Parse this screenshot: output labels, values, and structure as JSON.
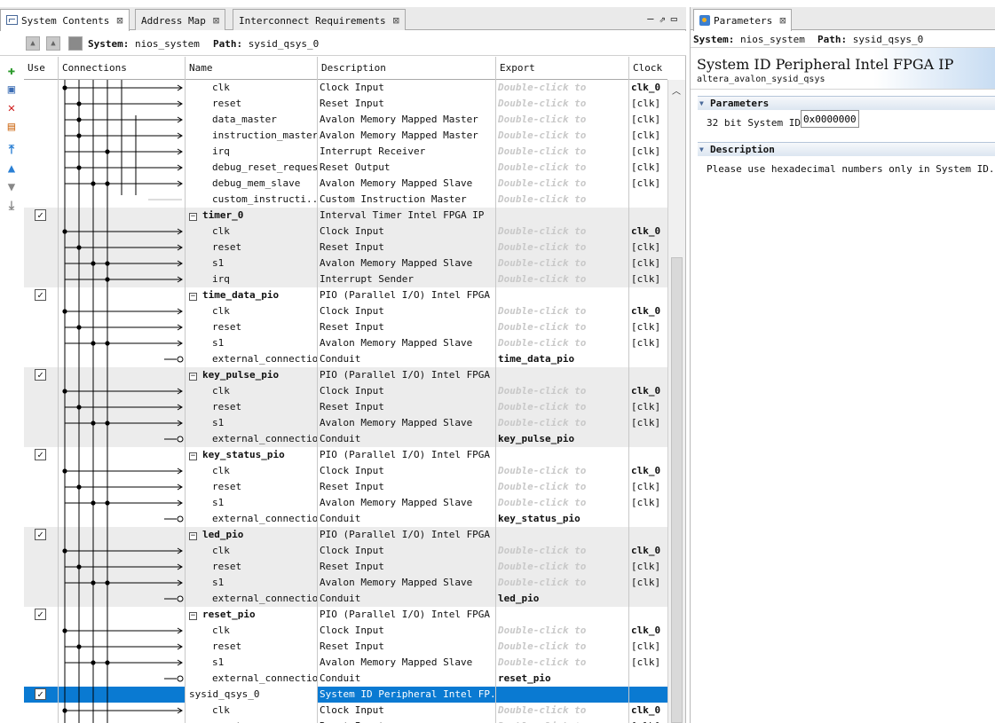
{
  "tabs": [
    {
      "label": "System Contents",
      "active": true
    },
    {
      "label": "Address Map",
      "active": false
    },
    {
      "label": "Interconnect Requirements",
      "active": false
    }
  ],
  "pathbar": {
    "system_label": "System:",
    "system_value": "nios_system",
    "path_label": "Path:",
    "path_value": "sysid_qsys_0"
  },
  "columns": {
    "use": "Use",
    "connections": "Connections",
    "name": "Name",
    "description": "Description",
    "export": "Export",
    "clock": "Clock"
  },
  "double_click_text": "Double-click to",
  "rows": [
    {
      "kind": "port",
      "name": "clk",
      "desc": "Clock Input",
      "export": "dbl",
      "clock": "clk_0",
      "clock_bold": true,
      "shade": false
    },
    {
      "kind": "port",
      "name": "reset",
      "desc": "Reset Input",
      "export": "dbl",
      "clock": "[clk]",
      "shade": false
    },
    {
      "kind": "port",
      "name": "data_master",
      "desc": "Avalon Memory Mapped Master",
      "export": "dbl",
      "clock": "[clk]",
      "shade": false
    },
    {
      "kind": "port",
      "name": "instruction_master",
      "desc": "Avalon Memory Mapped Master",
      "export": "dbl",
      "clock": "[clk]",
      "shade": false
    },
    {
      "kind": "port",
      "name": "irq",
      "desc": "Interrupt Receiver",
      "export": "dbl",
      "clock": "[clk]",
      "shade": false
    },
    {
      "kind": "port",
      "name": "debug_reset_request",
      "desc": "Reset Output",
      "export": "dbl",
      "clock": "[clk]",
      "shade": false
    },
    {
      "kind": "port",
      "name": "debug_mem_slave",
      "desc": "Avalon Memory Mapped Slave",
      "export": "dbl",
      "clock": "[clk]",
      "shade": false
    },
    {
      "kind": "port",
      "name": "custom_instructi...",
      "desc": "Custom Instruction Master",
      "export": "dbl",
      "clock": "",
      "shade": false
    },
    {
      "kind": "comp",
      "name": "timer_0",
      "desc": "Interval Timer Intel FPGA IP",
      "export": "",
      "clock": "",
      "shade": true
    },
    {
      "kind": "port",
      "name": "clk",
      "desc": "Clock Input",
      "export": "dbl",
      "clock": "clk_0",
      "clock_bold": true,
      "shade": true
    },
    {
      "kind": "port",
      "name": "reset",
      "desc": "Reset Input",
      "export": "dbl",
      "clock": "[clk]",
      "shade": true
    },
    {
      "kind": "port",
      "name": "s1",
      "desc": "Avalon Memory Mapped Slave",
      "export": "dbl",
      "clock": "[clk]",
      "shade": true
    },
    {
      "kind": "port",
      "name": "irq",
      "desc": "Interrupt Sender",
      "export": "dbl",
      "clock": "[clk]",
      "shade": true
    },
    {
      "kind": "comp",
      "name": "time_data_pio",
      "desc": "PIO (Parallel I/O) Intel FPGA IP",
      "export": "",
      "clock": "",
      "shade": false
    },
    {
      "kind": "port",
      "name": "clk",
      "desc": "Clock Input",
      "export": "dbl",
      "clock": "clk_0",
      "clock_bold": true,
      "shade": false
    },
    {
      "kind": "port",
      "name": "reset",
      "desc": "Reset Input",
      "export": "dbl",
      "clock": "[clk]",
      "shade": false
    },
    {
      "kind": "port",
      "name": "s1",
      "desc": "Avalon Memory Mapped Slave",
      "export": "dbl",
      "clock": "[clk]",
      "shade": false
    },
    {
      "kind": "port",
      "name": "external_connection",
      "desc": "Conduit",
      "export": "time_data_pio",
      "clock": "",
      "shade": false
    },
    {
      "kind": "comp",
      "name": "key_pulse_pio",
      "desc": "PIO (Parallel I/O) Intel FPGA IP",
      "export": "",
      "clock": "",
      "shade": true
    },
    {
      "kind": "port",
      "name": "clk",
      "desc": "Clock Input",
      "export": "dbl",
      "clock": "clk_0",
      "clock_bold": true,
      "shade": true
    },
    {
      "kind": "port",
      "name": "reset",
      "desc": "Reset Input",
      "export": "dbl",
      "clock": "[clk]",
      "shade": true
    },
    {
      "kind": "port",
      "name": "s1",
      "desc": "Avalon Memory Mapped Slave",
      "export": "dbl",
      "clock": "[clk]",
      "shade": true
    },
    {
      "kind": "port",
      "name": "external_connection",
      "desc": "Conduit",
      "export": "key_pulse_pio",
      "clock": "",
      "shade": true
    },
    {
      "kind": "comp",
      "name": "key_status_pio",
      "desc": "PIO (Parallel I/O) Intel FPGA IP",
      "export": "",
      "clock": "",
      "shade": false
    },
    {
      "kind": "port",
      "name": "clk",
      "desc": "Clock Input",
      "export": "dbl",
      "clock": "clk_0",
      "clock_bold": true,
      "shade": false
    },
    {
      "kind": "port",
      "name": "reset",
      "desc": "Reset Input",
      "export": "dbl",
      "clock": "[clk]",
      "shade": false
    },
    {
      "kind": "port",
      "name": "s1",
      "desc": "Avalon Memory Mapped Slave",
      "export": "dbl",
      "clock": "[clk]",
      "shade": false
    },
    {
      "kind": "port",
      "name": "external_connection",
      "desc": "Conduit",
      "export": "key_status_pio",
      "clock": "",
      "shade": false
    },
    {
      "kind": "comp",
      "name": "led_pio",
      "desc": "PIO (Parallel I/O) Intel FPGA IP",
      "export": "",
      "clock": "",
      "shade": true
    },
    {
      "kind": "port",
      "name": "clk",
      "desc": "Clock Input",
      "export": "dbl",
      "clock": "clk_0",
      "clock_bold": true,
      "shade": true
    },
    {
      "kind": "port",
      "name": "reset",
      "desc": "Reset Input",
      "export": "dbl",
      "clock": "[clk]",
      "shade": true
    },
    {
      "kind": "port",
      "name": "s1",
      "desc": "Avalon Memory Mapped Slave",
      "export": "dbl",
      "clock": "[clk]",
      "shade": true
    },
    {
      "kind": "port",
      "name": "external_connection",
      "desc": "Conduit",
      "export": "led_pio",
      "clock": "",
      "shade": true
    },
    {
      "kind": "comp",
      "name": "reset_pio",
      "desc": "PIO (Parallel I/O) Intel FPGA IP",
      "export": "",
      "clock": "",
      "shade": false
    },
    {
      "kind": "port",
      "name": "clk",
      "desc": "Clock Input",
      "export": "dbl",
      "clock": "clk_0",
      "clock_bold": true,
      "shade": false
    },
    {
      "kind": "port",
      "name": "reset",
      "desc": "Reset Input",
      "export": "dbl",
      "clock": "[clk]",
      "shade": false
    },
    {
      "kind": "port",
      "name": "s1",
      "desc": "Avalon Memory Mapped Slave",
      "export": "dbl",
      "clock": "[clk]",
      "shade": false
    },
    {
      "kind": "port",
      "name": "external_connection",
      "desc": "Conduit",
      "export": "reset_pio",
      "clock": "",
      "shade": false
    },
    {
      "kind": "comp",
      "name": "sysid_qsys_0",
      "desc": "System ID Peripheral Intel FP...",
      "export": "",
      "clock": "",
      "selected": true
    },
    {
      "kind": "port",
      "name": "clk",
      "desc": "Clock Input",
      "export": "dbl",
      "clock": "clk_0",
      "clock_bold": true,
      "shade": false
    },
    {
      "kind": "port",
      "name": "reset",
      "desc": "Reset Input",
      "export": "dbl",
      "clock": "[clk]",
      "shade": false
    }
  ],
  "right": {
    "tab_label": "Parameters",
    "system_label": "System:",
    "system_value": "nios_system",
    "path_label": "Path:",
    "path_value": "sysid_qsys_0",
    "title": "System ID Peripheral Intel FPGA IP",
    "subtitle": "altera_avalon_sysid_qsys",
    "parameters_header": "Parameters",
    "param_label": "32 bit System ID:",
    "param_value": "0x00000000",
    "description_header": "Description",
    "description_text": "Please use hexadecimal numbers only in System ID."
  }
}
